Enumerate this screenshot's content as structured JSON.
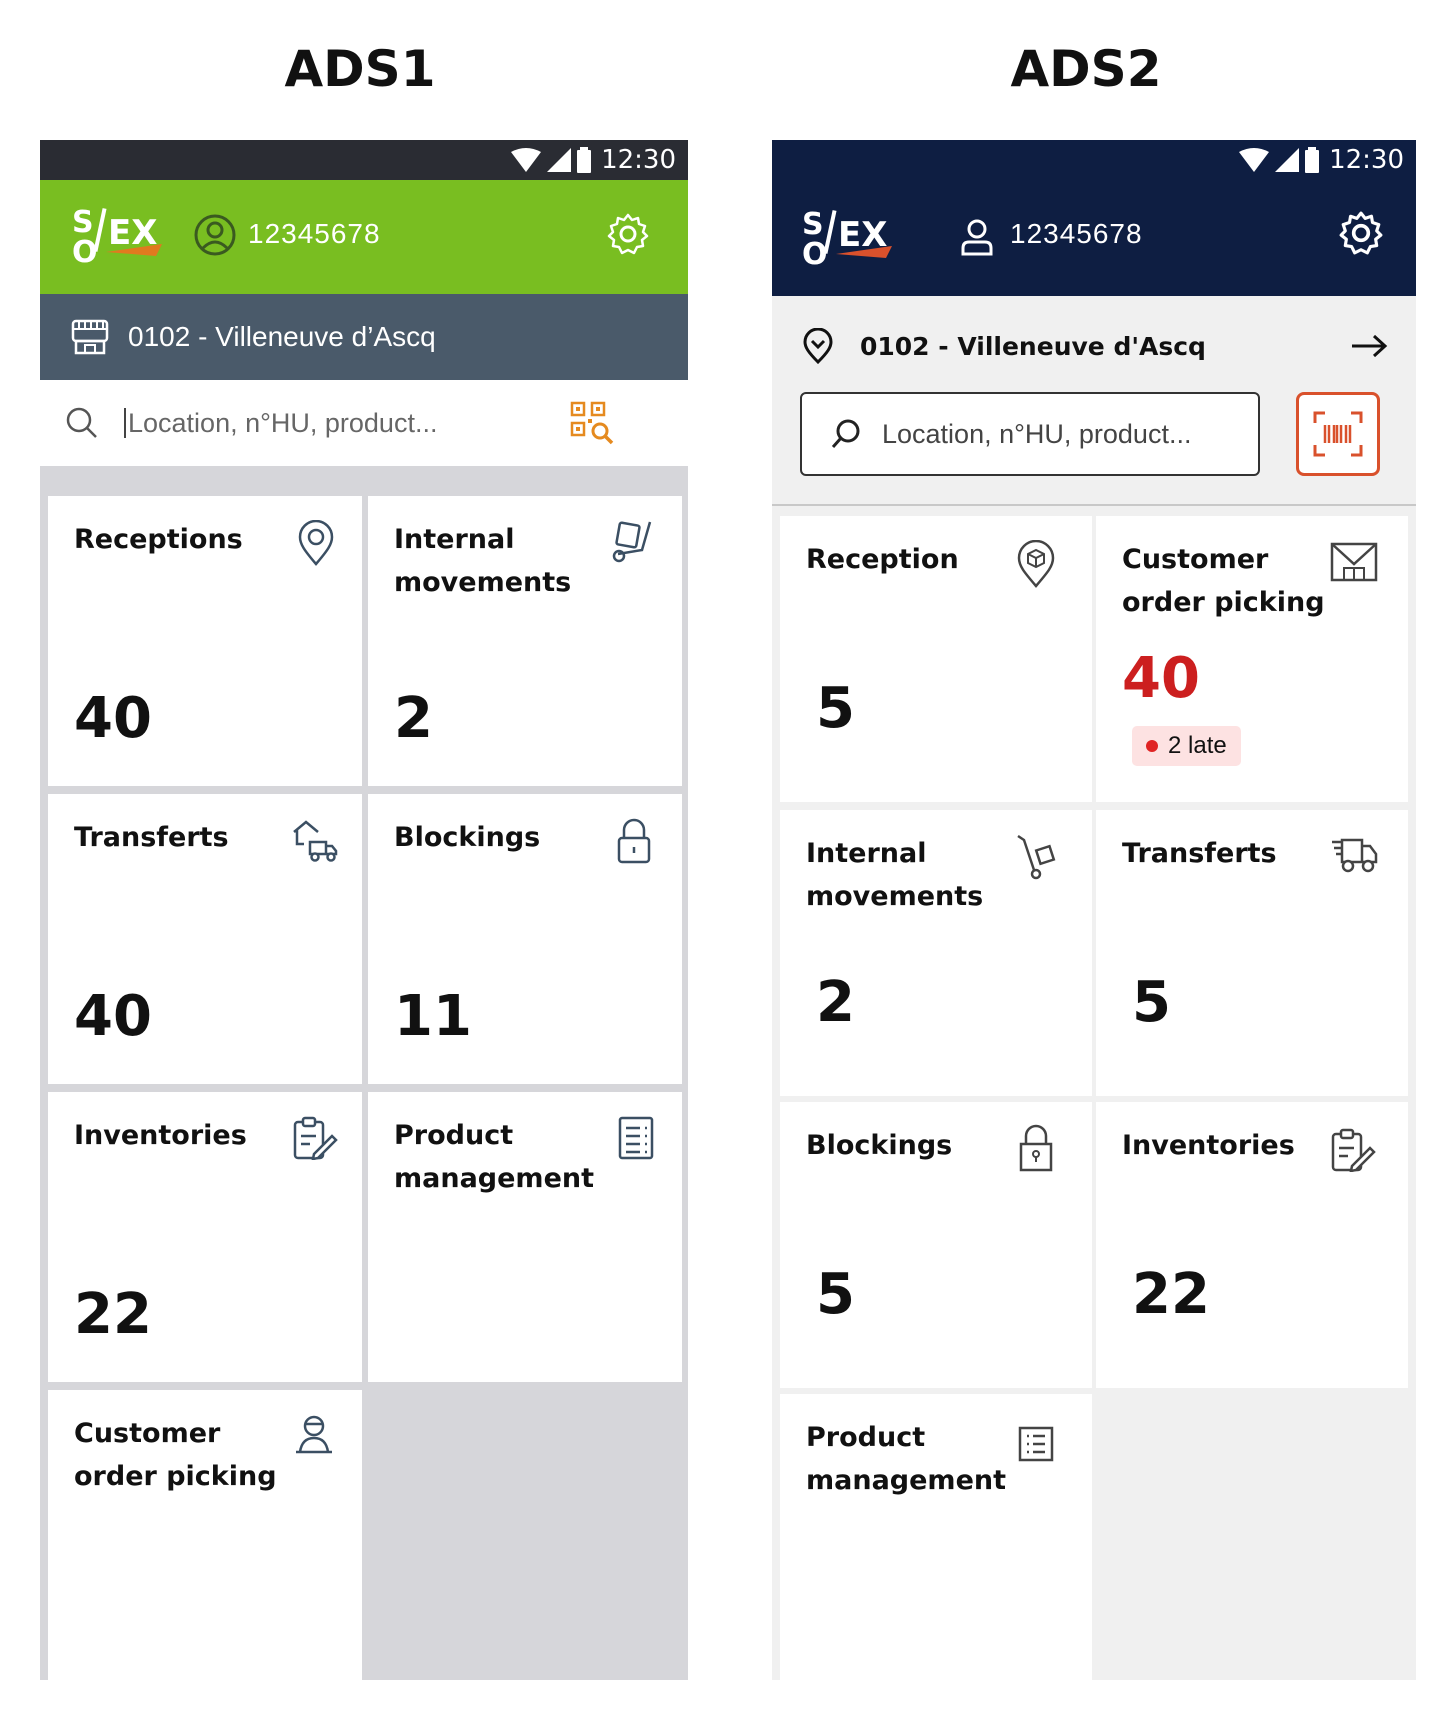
{
  "labels": {
    "left": "ADS1",
    "right": "ADS2"
  },
  "ads1": {
    "status_time": "12:30",
    "user_id": "12345678",
    "site": "0102 - Villeneuve d’Ascq",
    "search_placeholder": "Location, n°HU, product...",
    "tiles": [
      {
        "label": "Receptions",
        "count": "40",
        "icon": "map-pin-icon"
      },
      {
        "label": "Internal movements",
        "count": "2",
        "icon": "hand-truck-icon"
      },
      {
        "label": "Transferts",
        "count": "40",
        "icon": "warehouse-truck-icon"
      },
      {
        "label": "Blockings",
        "count": "11",
        "icon": "lock-icon"
      },
      {
        "label": "Inventories",
        "count": "22",
        "icon": "clipboard-edit-icon"
      },
      {
        "label": "Product management",
        "count": "",
        "icon": "list-icon"
      },
      {
        "label": "Customer order picking",
        "count": "",
        "icon": "picker-person-icon"
      }
    ],
    "colors": {
      "header": "#79be21",
      "location_bar": "#4a5a6a",
      "accent": "#e58a1f"
    }
  },
  "ads2": {
    "status_time": "12:30",
    "user_id": "12345678",
    "site": "0102 - Villeneuve d'Ascq",
    "search_placeholder": "Location, n°HU, product...",
    "tiles": [
      {
        "label": "Reception",
        "count": "5",
        "icon": "map-pin-box-icon"
      },
      {
        "label": "Customer order picking",
        "count": "40",
        "badge": "2 late",
        "icon": "envelope-shelf-icon"
      },
      {
        "label": "Internal movements",
        "count": "2",
        "icon": "hand-truck-icon"
      },
      {
        "label": "Transferts",
        "count": "5",
        "icon": "truck-icon"
      },
      {
        "label": "Blockings",
        "count": "5",
        "icon": "lock-icon"
      },
      {
        "label": "Inventories",
        "count": "22",
        "icon": "clipboard-edit-icon"
      },
      {
        "label": "Product management",
        "count": "",
        "icon": "list-icon"
      }
    ],
    "colors": {
      "header": "#0e1e42",
      "alert": "#cc1f1f",
      "accent": "#d9512c"
    }
  }
}
